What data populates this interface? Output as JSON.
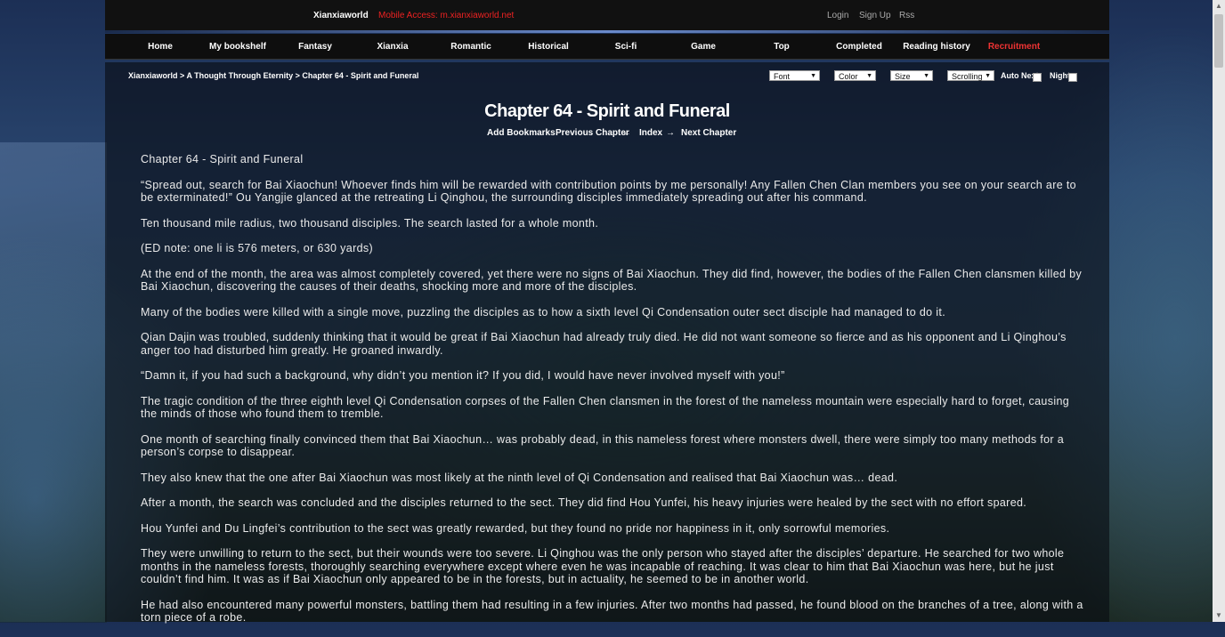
{
  "topbar": {
    "brand": "Xianxiaworld",
    "mobile": "Mobile Access: m.xianxiaworld.net",
    "login": "Login",
    "signup": "Sign Up",
    "rss": "Rss"
  },
  "nav": [
    {
      "label": "Home"
    },
    {
      "label": "My bookshelf"
    },
    {
      "label": "Fantasy"
    },
    {
      "label": "Xianxia"
    },
    {
      "label": "Romantic"
    },
    {
      "label": "Historical"
    },
    {
      "label": "Sci-fi"
    },
    {
      "label": "Game"
    },
    {
      "label": "Top"
    },
    {
      "label": "Completed"
    },
    {
      "label": "Reading history"
    },
    {
      "label": "Recruitment"
    }
  ],
  "breadcrumb": {
    "site": "Xianxiaworld",
    "sep": " > ",
    "book": "A Thought Through Eternity",
    "chapter": "Chapter 64 - Spirit and Funeral"
  },
  "controls": {
    "font": "Font",
    "color": "Color",
    "size": "Size",
    "scrolling": "Scrolling",
    "auto_next": "Auto Next",
    "night": "Night"
  },
  "chapter": {
    "title": "Chapter 64 - Spirit and Funeral",
    "add_bookmarks": "Add Bookmarks",
    "previous": "Previous Chapter",
    "arrow_left": "←",
    "index": "Index",
    "arrow_right": "→",
    "next": "Next Chapter"
  },
  "paragraphs": [
    "Chapter 64 - Spirit and Funeral",
    "“Spread out, search for Bai Xiaochun! Whoever finds him will be rewarded with contribution points by me personally! Any Fallen Chen Clan members you see on your search are to be exterminated!” Ou Yangjie glanced at the retreating Li Qinghou, the surrounding disciples immediately spreading out after his command.",
    "Ten thousand mile radius, two thousand disciples. The search lasted for a whole month.",
    "(ED note: one li is 576 meters, or 630 yards)",
    "At the end of the month, the area was almost completely covered, yet there were no signs of Bai Xiaochun. They did find, however, the bodies of the Fallen Chen clansmen killed by Bai Xiaochun, discovering the causes of their deaths, shocking more and more of the disciples.",
    "Many of the bodies were killed with a single move, puzzling the disciples as to how a sixth level Qi Condensation outer sect disciple had managed to do it.",
    "Qian Dajin was troubled, suddenly thinking that it would be great if Bai Xiaochun had already truly died. He did not want someone so fierce and as his opponent and Li Qinghou’s anger too had disturbed him greatly. He groaned inwardly.",
    "“Damn it, if you had such a background, why didn’t you mention it? If you did, I would have never involved myself with you!”",
    "The tragic condition of the three eighth level Qi Condensation corpses of the Fallen Chen clansmen in the forest of the nameless mountain were especially hard to forget, causing the minds of those who found them to tremble.",
    "One month of searching finally convinced them that Bai Xiaochun… was probably dead, in this nameless forest where monsters dwell, there were simply too many methods for a person’s corpse to disappear.",
    "They also knew that the one after Bai Xiaochun was most likely at the ninth level of Qi Condensation and realised that Bai Xiaochun was… dead.",
    "After a month, the search was concluded and the disciples returned to the sect. They did find Hou Yunfei, his heavy injuries were healed by the sect with no effort spared.",
    "Hou Yunfei and Du Lingfei’s contribution to the sect was greatly rewarded, but they found no pride nor happiness in it, only sorrowful memories.",
    "They were unwilling to return to the sect, but their wounds were too severe. Li Qinghou was the only person who stayed after the disciples’ departure. He searched for two whole months in the nameless forests, thoroughly searching everywhere except where even he was incapable of reaching. It was clear to him that Bai Xiaochun was here, but he just couldn’t find him. It was as if Bai Xiaochun only appeared to be in the forests, but in actuality, he seemed to be in another world.",
    "He had also encountered many powerful monsters, battling them had resulting in a few injuries. After two months had passed, he found blood on the branches of a tree, along with a torn piece of a robe."
  ]
}
